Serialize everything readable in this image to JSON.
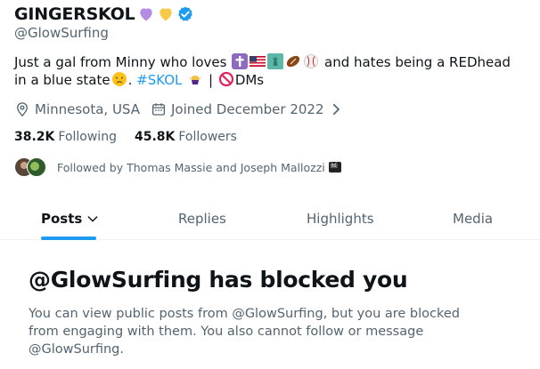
{
  "profile": {
    "display_name": "GINGERSKOL",
    "handle": "@GlowSurfing",
    "bio_text_1": "Just a gal from Minny who loves",
    "bio_text_2": "and hates being a REDhead in a blue state",
    "bio_hashtag": "#SKOL",
    "bio_text_3": "| ",
    "bio_dms": "DMs",
    "location": "Minnesota, USA",
    "joined": "Joined December 2022",
    "following_count": "38.2K",
    "following_label": "Following",
    "followers_count": "45.8K",
    "followers_label": "Followers",
    "followed_by": "Followed by Thomas Massie and Joseph Mallozzi"
  },
  "icons": {
    "verified": "verified-badge-icon",
    "location": "location-pin-icon",
    "calendar": "calendar-icon",
    "chevron": "chevron-right-icon",
    "heart_purple": "purple-heart-icon",
    "heart_yellow": "yellow-heart-icon"
  },
  "tabs": [
    {
      "label": "Posts",
      "active": true
    },
    {
      "label": "Replies",
      "active": false
    },
    {
      "label": "Highlights",
      "active": false
    },
    {
      "label": "Media",
      "active": false
    }
  ],
  "blocked": {
    "title": "@GlowSurfing has blocked you",
    "description": "You can view public posts from @GlowSurfing, but you are blocked from engaging with them. You also cannot follow or message @GlowSurfing."
  },
  "colors": {
    "accent": "#1d9bf0",
    "text_primary": "#0f1419",
    "text_secondary": "#536471"
  }
}
